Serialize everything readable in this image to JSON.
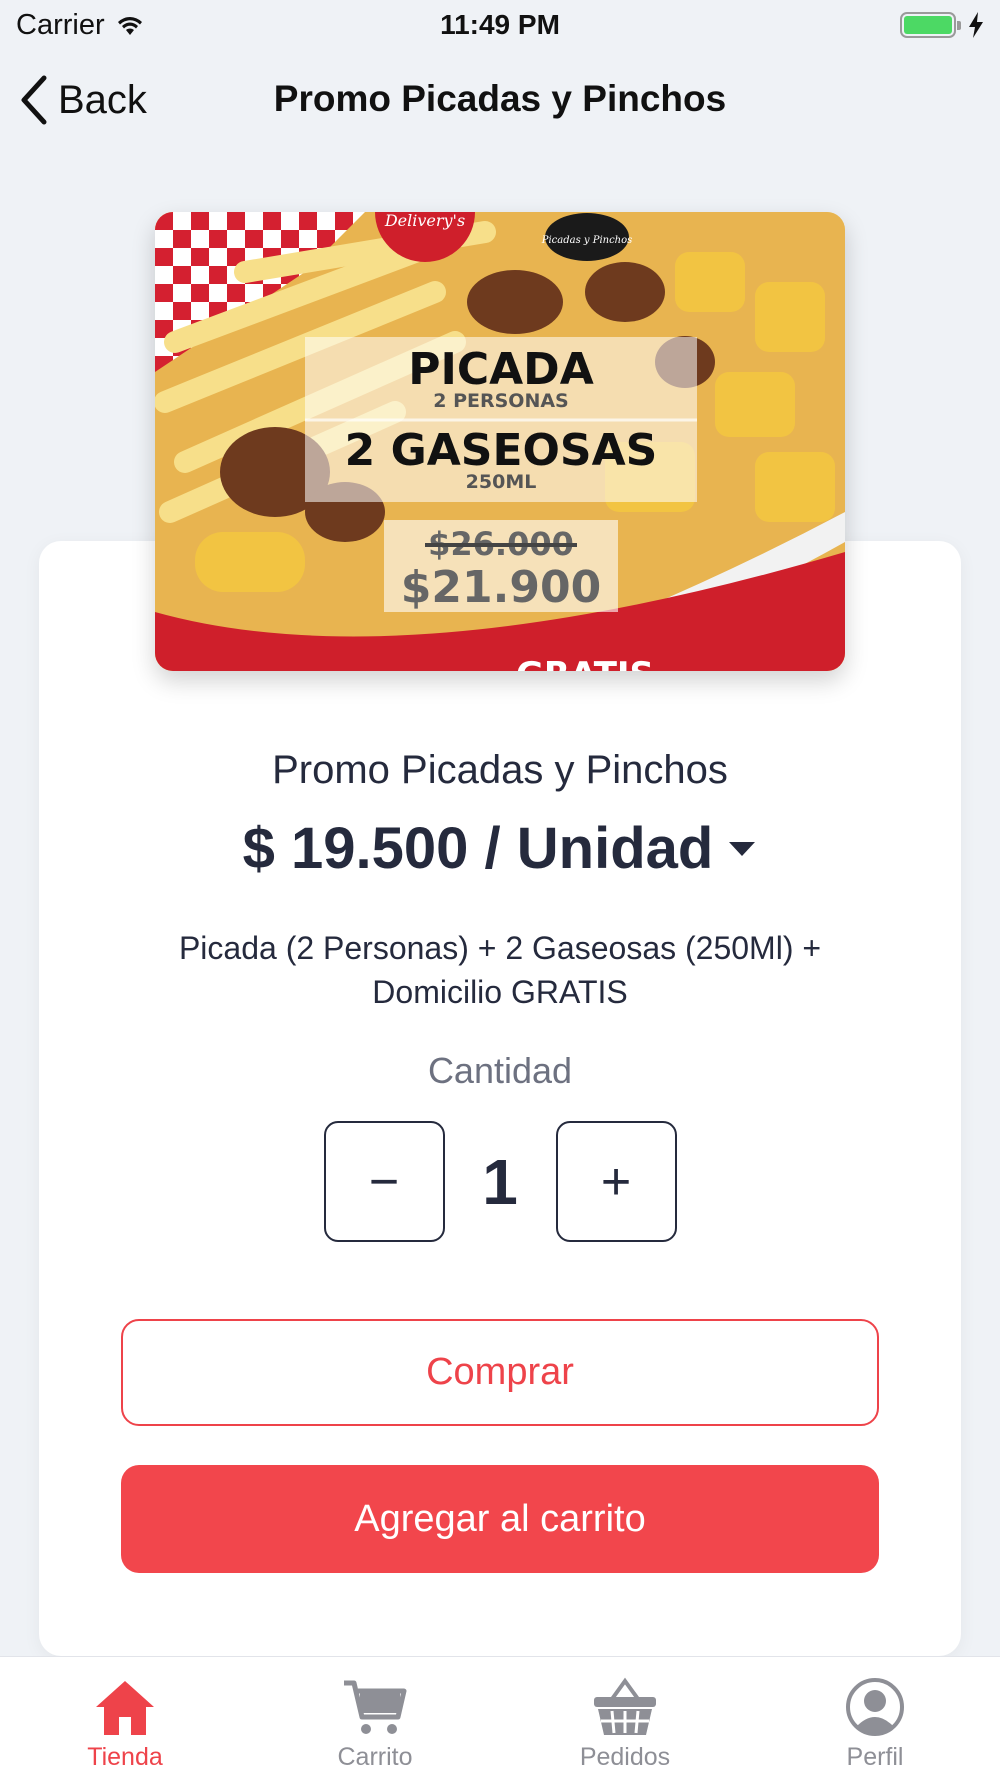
{
  "status_bar": {
    "carrier": "Carrier",
    "time": "11:49 PM"
  },
  "nav": {
    "back_label": "Back",
    "title": "Promo Picadas y Pinchos"
  },
  "product": {
    "image_texts": {
      "badge": "Delivery's",
      "logo": "Picadas y Pinchos",
      "line1": "PICADA",
      "line1_sub": "2 PERSONAS",
      "line2": "2 GASEOSAS",
      "line2_sub": "250ML",
      "old_price": "$26.000",
      "new_price": "$21.900",
      "bottom": "GRATIS"
    },
    "name": "Promo Picadas y Pinchos",
    "price": "$ 19.500 / Unidad",
    "description": "Picada (2 Personas) + 2 Gaseosas (250Ml) + Domicilio GRATIS"
  },
  "quantity": {
    "label": "Cantidad",
    "value": "1",
    "minus": "−",
    "plus": "+"
  },
  "actions": {
    "buy_label": "Comprar",
    "add_to_cart_label": "Agregar al carrito"
  },
  "tabs": [
    {
      "label": "Tienda",
      "icon": "home-icon",
      "active": true
    },
    {
      "label": "Carrito",
      "icon": "cart-icon",
      "active": false
    },
    {
      "label": "Pedidos",
      "icon": "basket-icon",
      "active": false
    },
    {
      "label": "Perfil",
      "icon": "profile-icon",
      "active": false
    }
  ],
  "colors": {
    "accent": "#ee434a",
    "text": "#252a3d",
    "background": "#eff2f6"
  }
}
